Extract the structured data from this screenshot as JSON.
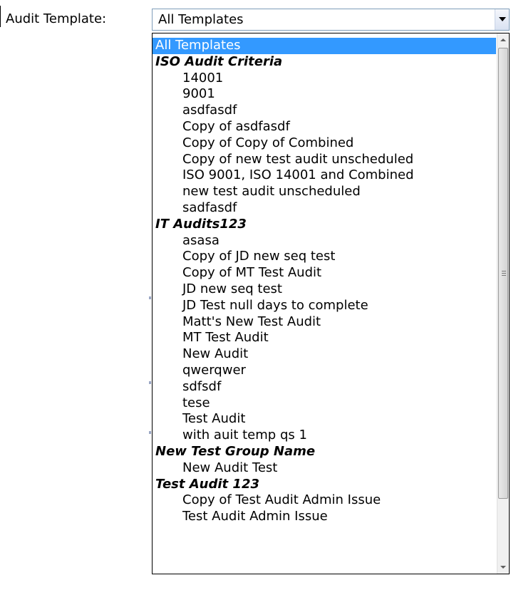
{
  "form": {
    "label": "Audit Template:",
    "selected_value": "All Templates"
  },
  "dropdown": {
    "options": [
      {
        "type": "selected",
        "text": "All Templates"
      },
      {
        "type": "group",
        "text": "ISO Audit Criteria"
      },
      {
        "type": "item",
        "text": "14001"
      },
      {
        "type": "item",
        "text": "9001"
      },
      {
        "type": "item",
        "text": "asdfasdf"
      },
      {
        "type": "item",
        "text": "Copy of asdfasdf"
      },
      {
        "type": "item",
        "text": "Copy of Copy of Combined"
      },
      {
        "type": "item",
        "text": "Copy of new test audit unscheduled"
      },
      {
        "type": "item",
        "text": "ISO 9001, ISO 14001 and Combined"
      },
      {
        "type": "item",
        "text": "new test audit unscheduled"
      },
      {
        "type": "item",
        "text": "sadfasdf"
      },
      {
        "type": "group",
        "text": "IT Audits123"
      },
      {
        "type": "item",
        "text": "asasa"
      },
      {
        "type": "item",
        "text": "Copy of JD new seq test"
      },
      {
        "type": "item",
        "text": "Copy of MT Test Audit"
      },
      {
        "type": "item",
        "text": "JD new seq test"
      },
      {
        "type": "item",
        "text": "JD Test null days to complete"
      },
      {
        "type": "item",
        "text": "Matt's New Test Audit"
      },
      {
        "type": "item",
        "text": "MT Test Audit"
      },
      {
        "type": "item",
        "text": "New Audit"
      },
      {
        "type": "item",
        "text": "qwerqwer"
      },
      {
        "type": "item",
        "text": "sdfsdf"
      },
      {
        "type": "item",
        "text": "tese"
      },
      {
        "type": "item",
        "text": "Test Audit"
      },
      {
        "type": "item",
        "text": "with auit temp qs 1"
      },
      {
        "type": "group",
        "text": "New Test Group Name"
      },
      {
        "type": "item",
        "text": "New Audit Test"
      },
      {
        "type": "group",
        "text": "Test Audit 123"
      },
      {
        "type": "item",
        "text": "Copy of Test Audit Admin Issue"
      },
      {
        "type": "item",
        "text": "Test Audit Admin Issue"
      }
    ]
  },
  "colors": {
    "selection": "#3399ff",
    "select_border": "#7f9db9"
  }
}
